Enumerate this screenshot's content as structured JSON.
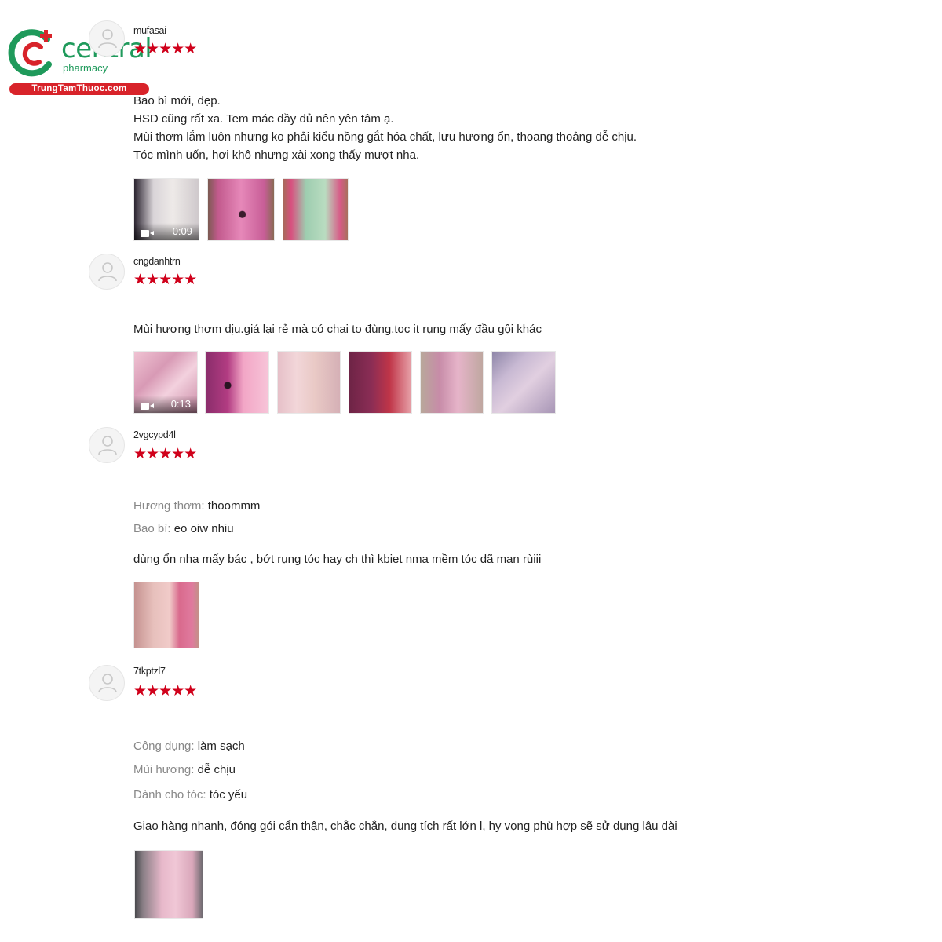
{
  "brand": {
    "name": "central",
    "sub": "pharmacy",
    "tagline": "TrungTamThuoc.com",
    "icon": "pharmacy-cross-logo-icon",
    "color_green": "#1f9a5b",
    "color_red": "#d8232a"
  },
  "star_color": "#d0011b",
  "reviews": [
    {
      "username": "mufasai",
      "stars": "★★★★★",
      "rating": 5,
      "lines": [
        "Bao bì mới, đẹp.",
        "HSD cũng rất xa. Tem mác đầy đủ nên yên tâm ạ.",
        "Mùi thơm lắm luôn nhưng ko phải kiểu nồng gắt hóa chất, lưu hương ổn, thoang thoảng dễ chịu.",
        "Tóc mình uốn, hơi khô nhưng xài xong thấy mượt nha."
      ],
      "media": [
        {
          "kind": "video",
          "duration": "0:09"
        },
        {
          "kind": "image"
        },
        {
          "kind": "image"
        }
      ]
    },
    {
      "username": "cngdanhtrn",
      "stars": "★★★★★",
      "rating": 5,
      "lines": [
        "Mùi hương thơm dịu.giá lại rẻ mà có chai to đùng.toc it rụng mấy đầu gội khác"
      ],
      "media": [
        {
          "kind": "video",
          "duration": "0:13"
        },
        {
          "kind": "image"
        },
        {
          "kind": "image"
        },
        {
          "kind": "image"
        },
        {
          "kind": "image"
        },
        {
          "kind": "image"
        }
      ]
    },
    {
      "username": "2vgcypd4l",
      "stars": "★★★★★",
      "rating": 5,
      "attributes": [
        {
          "label": "Hương thơm:",
          "value": "thoommm"
        },
        {
          "label": "Bao bì:",
          "value": "eo oiw nhiu"
        }
      ],
      "lines": [
        "dùng ổn nha mấy bác , bớt rụng tóc hay ch thì kbiet nma mềm tóc dã man rùiii"
      ],
      "media": [
        {
          "kind": "image"
        }
      ]
    },
    {
      "username": "7tkptzl7",
      "stars": "★★★★★",
      "rating": 5,
      "attributes": [
        {
          "label": "Công dụng:",
          "value": "làm sạch"
        },
        {
          "label": "Mùi hương:",
          "value": "dễ chịu"
        },
        {
          "label": "Dành cho tóc:",
          "value": "tóc yếu"
        }
      ],
      "lines": [
        "Giao hàng nhanh, đóng gói cẩn thận, chắc chắn, dung tích rất lớn l, hy vọng phù hợp sẽ sử dụng lâu dài"
      ],
      "media": [
        {
          "kind": "image"
        }
      ]
    }
  ]
}
